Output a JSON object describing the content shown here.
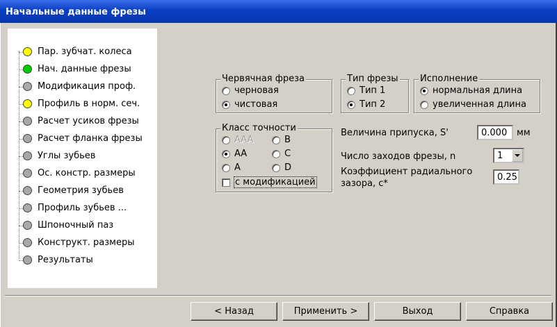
{
  "window": {
    "title": "Начальные данные фрезы"
  },
  "tree": {
    "items": [
      {
        "label": "Пар. зубчат. колеса",
        "status": "yellow",
        "color": "#ffff00"
      },
      {
        "label": "Нач. данные фрезы",
        "status": "green",
        "color": "#00cc00"
      },
      {
        "label": "Модификация проф.",
        "status": "gray",
        "color": "#a8a8a8"
      },
      {
        "label": "Профиль в норм. сеч.",
        "status": "yellow",
        "color": "#ffff00"
      },
      {
        "label": "Расчет усиков фрезы",
        "status": "gray",
        "color": "#a8a8a8"
      },
      {
        "label": "Расчет фланка фрезы",
        "status": "gray",
        "color": "#a8a8a8"
      },
      {
        "label": "Углы зубьев",
        "status": "gray",
        "color": "#a8a8a8"
      },
      {
        "label": "Ос. констр. размеры",
        "status": "gray",
        "color": "#a8a8a8"
      },
      {
        "label": "Геометрия зубьев",
        "status": "gray",
        "color": "#a8a8a8"
      },
      {
        "label": "Профиль зубьев ...",
        "status": "gray",
        "color": "#a8a8a8"
      },
      {
        "label": "Шпоночный паз",
        "status": "gray",
        "color": "#a8a8a8"
      },
      {
        "label": "Конструкт. размеры",
        "status": "gray",
        "color": "#a8a8a8"
      },
      {
        "label": "Результаты",
        "status": "gray",
        "color": "#a8a8a8"
      }
    ]
  },
  "hob_type": {
    "title": "Червячная  фреза",
    "options": [
      {
        "label": "черновая",
        "selected": false
      },
      {
        "label": "чистовая",
        "selected": true
      }
    ]
  },
  "cutter_type": {
    "title": "Тип фрезы",
    "options": [
      {
        "label": "Тип 1",
        "selected": false
      },
      {
        "label": "Тип 2",
        "selected": true
      }
    ]
  },
  "execution": {
    "title": "Исполнение",
    "options": [
      {
        "label": "нормальная длина",
        "selected": true
      },
      {
        "label": "увеличенная длина",
        "selected": false
      }
    ]
  },
  "accuracy": {
    "title": "Класс точности",
    "options": [
      {
        "label": "AAA",
        "selected": false,
        "disabled": true
      },
      {
        "label": "B",
        "selected": false,
        "disabled": false
      },
      {
        "label": "AA",
        "selected": true,
        "disabled": false
      },
      {
        "label": "C",
        "selected": false,
        "disabled": false
      },
      {
        "label": "A",
        "selected": false,
        "disabled": false
      },
      {
        "label": "D",
        "selected": false,
        "disabled": false
      }
    ],
    "modification_label": "с модификацией",
    "modification_checked": false
  },
  "params": {
    "allowance_label": "Величина припуска, S'",
    "allowance_value": "0.000",
    "allowance_unit": "мм",
    "starts_label": "Число заходов фрезы, n",
    "starts_value": "1",
    "clearance_label_line1": "Коэффициент радиального",
    "clearance_label_line2": "зазора, с*",
    "clearance_value": "0.25"
  },
  "buttons": {
    "back": "< Назад",
    "apply": "Применить >",
    "exit": "Выход",
    "help": "Справка"
  }
}
